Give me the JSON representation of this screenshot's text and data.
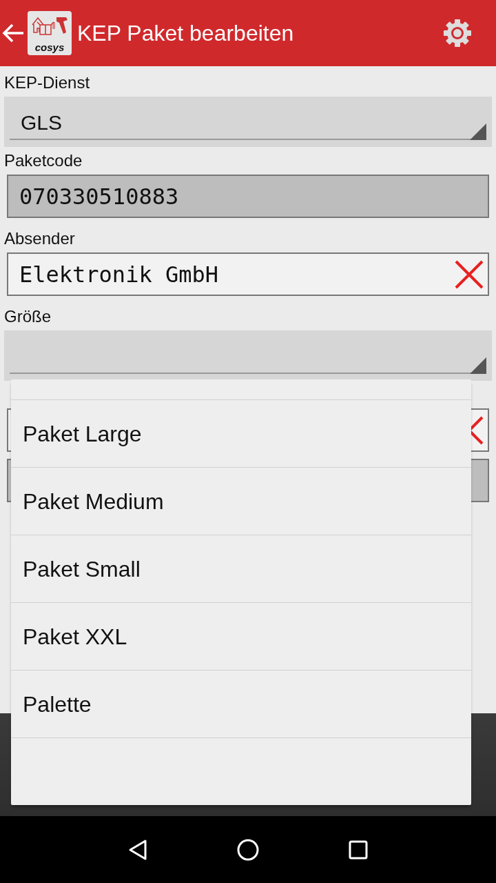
{
  "app_bar": {
    "logo_text": "cosys",
    "title": "KEP Paket bearbeiten"
  },
  "form": [
    {
      "kind": "spinner",
      "label": "KEP-Dienst",
      "value": "GLS"
    },
    {
      "kind": "readonly",
      "label": "Paketcode",
      "value": "070330510883"
    },
    {
      "kind": "clearable",
      "label": "Absender",
      "value": "Elektronik GmbH"
    },
    {
      "kind": "spinner",
      "label": "Größe"
    },
    {
      "kind": "gap"
    },
    {
      "kind": "clearable"
    },
    {
      "kind": "readonly"
    }
  ],
  "dropdown": {
    "options": [
      {
        "label": "Paket Large",
        "selected": false
      },
      {
        "label": "Paket Medium",
        "selected": false
      },
      {
        "label": "Paket Small",
        "selected": false
      },
      {
        "label": "Paket XXL",
        "selected": false
      },
      {
        "label": "Palette",
        "selected": false
      }
    ]
  }
}
